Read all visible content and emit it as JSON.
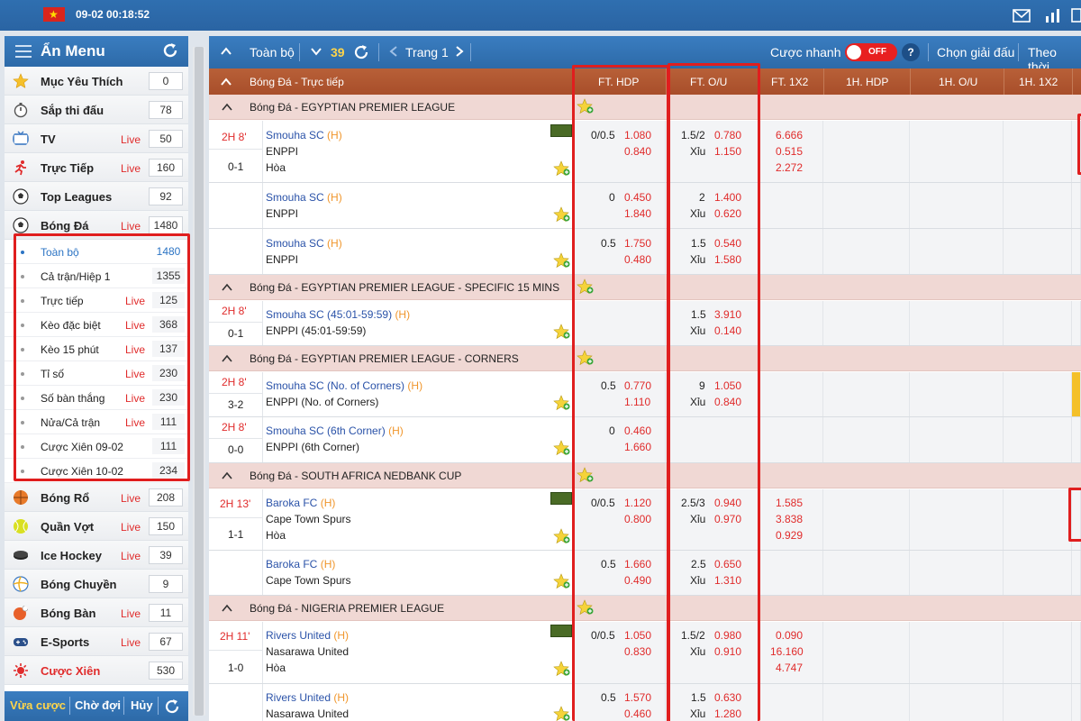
{
  "header": {
    "datetime": "09-02 00:18:52",
    "flag_icon": "vietnam-flag-icon"
  },
  "colors": {
    "brand_blue": "#2d6aa8",
    "header_brown": "#a84e2a",
    "league_pink": "#f0d8d4",
    "live_red": "#e02b2b",
    "highlight_red": "#e01e1e"
  },
  "sidebar": {
    "title": "Ẩn Menu",
    "items_top": [
      {
        "label": "Mục Yêu Thích",
        "live": "",
        "count": "0",
        "icon": "star-icon"
      },
      {
        "label": "Sắp thi đấu",
        "live": "",
        "count": "78",
        "icon": "stopwatch-icon"
      },
      {
        "label": "TV",
        "live": "Live",
        "count": "50",
        "icon": "tv-icon"
      },
      {
        "label": "Trực Tiếp",
        "live": "Live",
        "count": "160",
        "icon": "runner-icon"
      },
      {
        "label": "Top Leagues",
        "live": "",
        "count": "92",
        "icon": "soccer-ball-icon"
      },
      {
        "label": "Bóng Đá",
        "live": "Live",
        "count": "1480",
        "icon": "soccer-ball-icon"
      }
    ],
    "sub_items": [
      {
        "label": "Toàn bộ",
        "live": "",
        "count": "1480"
      },
      {
        "label": "Cả trận/Hiệp 1",
        "live": "",
        "count": "1355"
      },
      {
        "label": "Trực tiếp",
        "live": "Live",
        "count": "125"
      },
      {
        "label": "Kèo đặc biệt",
        "live": "Live",
        "count": "368"
      },
      {
        "label": "Kèo 15 phút",
        "live": "Live",
        "count": "137"
      },
      {
        "label": "Tỉ số",
        "live": "Live",
        "count": "230"
      },
      {
        "label": "Số bàn thắng",
        "live": "Live",
        "count": "230"
      },
      {
        "label": "Nửa/Cả trận",
        "live": "Live",
        "count": "111"
      },
      {
        "label": "Cược Xiên 09-02",
        "live": "",
        "count": "111"
      },
      {
        "label": "Cược Xiên 10-02",
        "live": "",
        "count": "234"
      }
    ],
    "items_bottom": [
      {
        "label": "Bóng Rổ",
        "live": "Live",
        "count": "208",
        "icon": "basketball-icon"
      },
      {
        "label": "Quần Vợt",
        "live": "Live",
        "count": "150",
        "icon": "tennis-ball-icon"
      },
      {
        "label": "Ice Hockey",
        "live": "Live",
        "count": "39",
        "icon": "hockey-puck-icon"
      },
      {
        "label": "Bóng Chuyền",
        "live": "",
        "count": "9",
        "icon": "volleyball-icon"
      },
      {
        "label": "Bóng Bàn",
        "live": "Live",
        "count": "11",
        "icon": "table-tennis-icon"
      },
      {
        "label": "E-Sports",
        "live": "Live",
        "count": "67",
        "icon": "gamepad-icon"
      },
      {
        "label": "Cược Xiên",
        "live": "",
        "count": "530",
        "icon": "parlay-icon"
      }
    ],
    "footer": {
      "bets": "Vừa cược",
      "waiting": "Chờ đợi",
      "cancel": "Hủy"
    }
  },
  "toolbar": {
    "all": "Toàn bộ",
    "count": "39",
    "page": "Trang 1",
    "quick_bet": "Cược nhanh",
    "toggle": "OFF",
    "help": "?",
    "choose_league": "Chọn giải đấu",
    "sort_by": "Theo thời"
  },
  "columns": {
    "section": "Bóng Đá - Trực tiếp",
    "ft_hdp": "FT. HDP",
    "ft_ou": "FT. O/U",
    "ft_1x2": "FT. 1X2",
    "h1_hdp": "1H. HDP",
    "h1_ou": "1H. O/U",
    "h1_1x2": "1H. 1X2"
  },
  "leagues": {
    "l1": "Bóng Đá - EGYPTIAN PREMIER LEAGUE",
    "l2": "Bóng Đá - EGYPTIAN PREMIER LEAGUE - SPECIFIC 15 MINS",
    "l3": "Bóng Đá - EGYPTIAN PREMIER LEAGUE - CORNERS",
    "l4": "Bóng Đá - SOUTH AFRICA NEDBANK CUP",
    "l5": "Bóng Đá - NIGERIA PREMIER LEAGUE"
  },
  "rows": {
    "r1": {
      "time": "2H 8'",
      "score": "0-1",
      "home": "Smouha SC",
      "h": "(H)",
      "away": "ENPPI",
      "draw": "Hòa",
      "hdp": "0/0.5",
      "hdp_home": "1.080",
      "hdp_away": "0.840",
      "ou": "1.5/2",
      "ou_over": "0.780",
      "xiu": "Xỉu",
      "ou_under": "1.150",
      "x1": "6.666",
      "x2": "0.515",
      "x3": "2.272"
    },
    "r2": {
      "home": "Smouha SC",
      "h": "(H)",
      "away": "ENPPI",
      "hdp": "0",
      "hdp_home": "0.450",
      "hdp_away": "1.840",
      "ou": "2",
      "ou_over": "1.400",
      "xiu": "Xỉu",
      "ou_under": "0.620"
    },
    "r3": {
      "home": "Smouha SC",
      "h": "(H)",
      "away": "ENPPI",
      "hdp": "0.5",
      "hdp_home": "1.750",
      "hdp_away": "0.480",
      "ou": "1.5",
      "ou_over": "0.540",
      "xiu": "Xỉu",
      "ou_under": "1.580"
    },
    "r4": {
      "time": "2H 8'",
      "score": "0-1",
      "home": "Smouha SC (45:01-59:59)",
      "h": "(H)",
      "away": "ENPPI (45:01-59:59)",
      "ou": "1.5",
      "ou_over": "3.910",
      "xiu": "Xỉu",
      "ou_under": "0.140"
    },
    "r5": {
      "time": "2H 8'",
      "score": "3-2",
      "home": "Smouha SC (No. of Corners)",
      "h": "(H)",
      "away": "ENPPI (No. of Corners)",
      "hdp": "0.5",
      "hdp_home": "0.770",
      "hdp_away": "1.110",
      "ou": "9",
      "ou_over": "1.050",
      "xiu": "Xỉu",
      "ou_under": "0.840"
    },
    "r6": {
      "time": "2H 8'",
      "score": "0-0",
      "home": "Smouha SC (6th Corner)",
      "h": "(H)",
      "away": "ENPPI (6th Corner)",
      "hdp": "0",
      "hdp_home": "0.460",
      "hdp_away": "1.660"
    },
    "r7": {
      "time": "2H 13'",
      "score": "1-1",
      "home": "Baroka FC",
      "h": "(H)",
      "away": "Cape Town Spurs",
      "draw": "Hòa",
      "hdp": "0/0.5",
      "hdp_home": "1.120",
      "hdp_away": "0.800",
      "ou": "2.5/3",
      "ou_over": "0.940",
      "xiu": "Xỉu",
      "ou_under": "0.970",
      "x1": "1.585",
      "x2": "3.838",
      "x3": "0.929"
    },
    "r8": {
      "home": "Baroka FC",
      "h": "(H)",
      "away": "Cape Town Spurs",
      "hdp": "0.5",
      "hdp_home": "1.660",
      "hdp_away": "0.490",
      "ou": "2.5",
      "ou_over": "0.650",
      "xiu": "Xỉu",
      "ou_under": "1.310"
    },
    "r9": {
      "time": "2H 11'",
      "score": "1-0",
      "home": "Rivers United",
      "h": "(H)",
      "away": "Nasarawa United",
      "draw": "Hòa",
      "hdp": "0/0.5",
      "hdp_home": "1.050",
      "hdp_away": "0.830",
      "ou": "1.5/2",
      "ou_over": "0.980",
      "xiu": "Xỉu",
      "ou_under": "0.910",
      "x1": "0.090",
      "x2": "16.160",
      "x3": "4.747"
    },
    "r10": {
      "home": "Rivers United",
      "h": "(H)",
      "away": "Nasarawa United",
      "hdp": "0.5",
      "hdp_home": "1.570",
      "hdp_away": "0.460",
      "ou": "1.5",
      "ou_over": "0.630",
      "xiu": "Xỉu",
      "ou_under": "1.280"
    }
  }
}
